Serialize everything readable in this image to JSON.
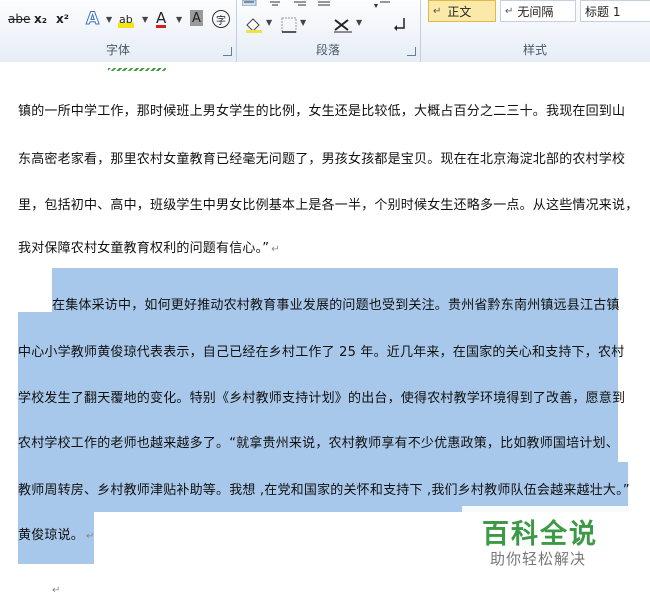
{
  "ribbon": {
    "font_group_label": "字体",
    "paragraph_group_label": "段落",
    "styles_group_label": "样式",
    "font_buttons": {
      "strikethrough": "abe",
      "subscript": "x₂",
      "superscript": "x²",
      "text_effects": "A",
      "highlight": "ab",
      "font_color": "A",
      "char_shading": "A",
      "enclose_char": "字"
    },
    "styles": [
      "正文",
      "无间隔",
      "标题 1"
    ],
    "active_style": "正文",
    "style_prefix_mark": "↵"
  },
  "document": {
    "lines": [
      "镇的一所中学工作，那时候班上男女学生的比例，女生还是比较低，大概占百分之二三十。我现在回到山",
      "东高密老家看，那里农村女童教育已经毫无问题了，男孩女孩都是宝贝。现在在北京海淀北部的农村学校",
      "里，包括初中、高中，班级学生中男女比例基本上是各一半，个别时候女生还略多一点。从这些情况来说，",
      "我对保障农村女童教育权利的问题有信心。”",
      "在集体采访中，如何更好推动农村教育事业发展的问题也受到关注。贵州省黔东南州镇远县江古镇",
      "中心小学教师黄俊琼代表表示，自己已经在乡村工作了 25 年。近几年来，在国家的关心和支持下，农村",
      "学校发生了翻天覆地的变化。特别《乡村教师支持计划》的出台，使得农村教学环境得到了改善，愿意到",
      "农村学校工作的老师也越来越多了。“就拿贵州来说，农村教师享有不少优惠政策，比如教师国培计划、",
      "教师周转房、乡村教师津贴补助等。我想 ,在党和国家的关怀和支持下 ,我们乡村教师队伍会越来越壮大。”",
      "黄俊琼说。"
    ],
    "paragraph_mark": "↵",
    "selection_color": "#a7c8ea"
  },
  "watermark": {
    "title": "百科全说",
    "subtitle": "助你轻松解决",
    "color": "#3c9a47"
  }
}
